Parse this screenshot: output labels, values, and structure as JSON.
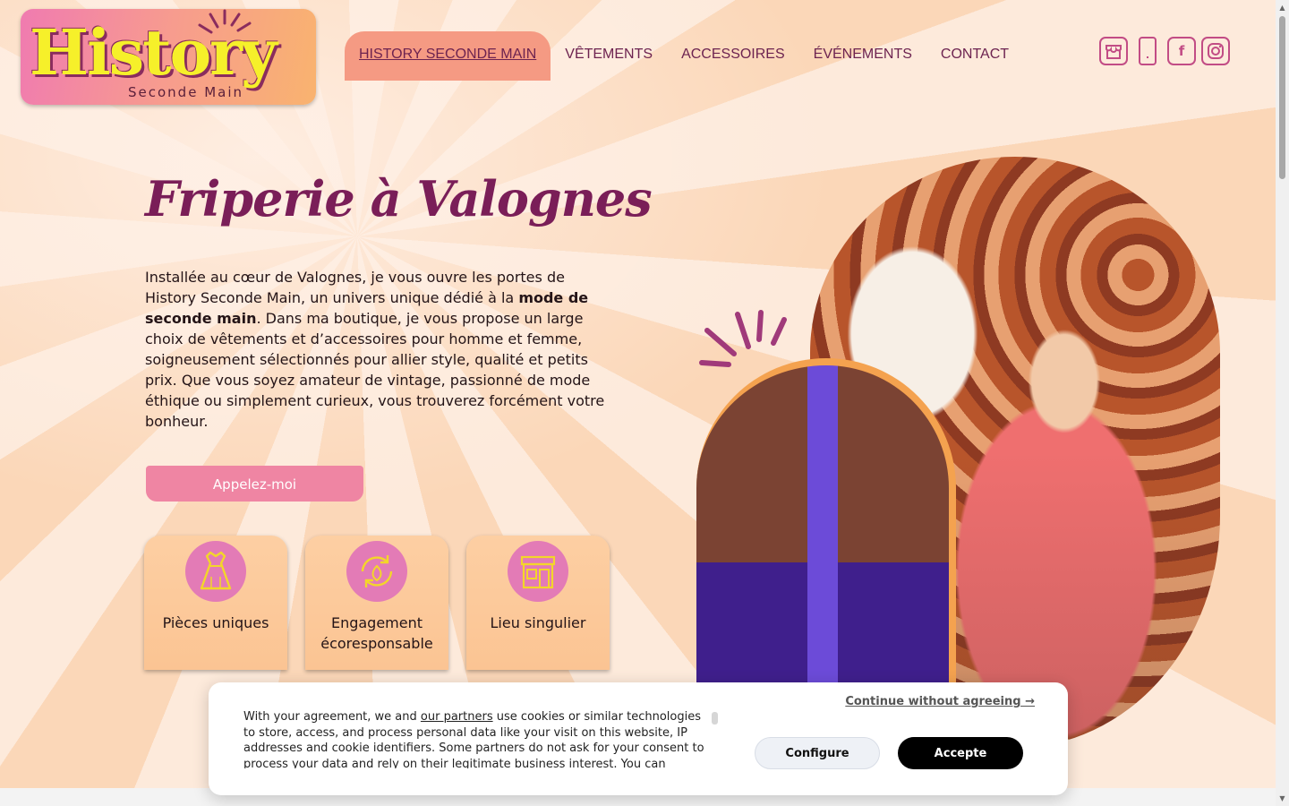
{
  "logo": {
    "word": "History",
    "sub": "Seconde Main"
  },
  "nav": {
    "items": [
      {
        "label": "HISTORY SECONDE MAIN"
      },
      {
        "label": "VÊTEMENTS"
      },
      {
        "label": "ACCESSOIRES"
      },
      {
        "label": "ÉVÉNEMENTS"
      },
      {
        "label": "CONTACT"
      }
    ]
  },
  "social": {
    "icons": [
      "shop-icon",
      "phone-icon",
      "facebook-icon",
      "instagram-icon"
    ],
    "facebook_glyph": "f"
  },
  "hero": {
    "title": "Friperie à Valognes",
    "text_part1": "Installée au cœur de Valognes, je vous ouvre les portes de History Seconde Main, un univers unique dédié à la ",
    "text_bold": "mode de seconde main",
    "text_part2": ". Dans ma boutique, je vous propose un large choix de vêtements et d’accessoires pour homme et femme, soigneusement sélectionnés pour allier style, qualité et petits prix. Que vous soyez amateur de vintage, passionné de mode éthique ou simplement curieux, vous trouverez forcément votre bonheur.",
    "cta": "Appelez-moi"
  },
  "features": [
    {
      "label": "Pièces uniques",
      "icon": "dress-icon"
    },
    {
      "label": "Engagement écoresponsable",
      "icon": "eco-recycle-icon"
    },
    {
      "label": "Lieu singulier",
      "icon": "shop-front-icon"
    }
  ],
  "cookie": {
    "text_before": "With your agreement, we and ",
    "link": "our partners",
    "text_after": " use cookies or similar technologies to store, access, and process personal data like your visit on this website, IP addresses and cookie identifiers. Some partners do not ask for your consent to process your data and rely on their legitimate business interest. You can",
    "continue": "Continue without agreeing →",
    "configure": "Configure",
    "accept": "Accepte"
  },
  "colors": {
    "accent_pink": "#ef85a3",
    "nav_text": "#6d2350",
    "title": "#7a1e58",
    "active_tab": "#f59a83"
  }
}
